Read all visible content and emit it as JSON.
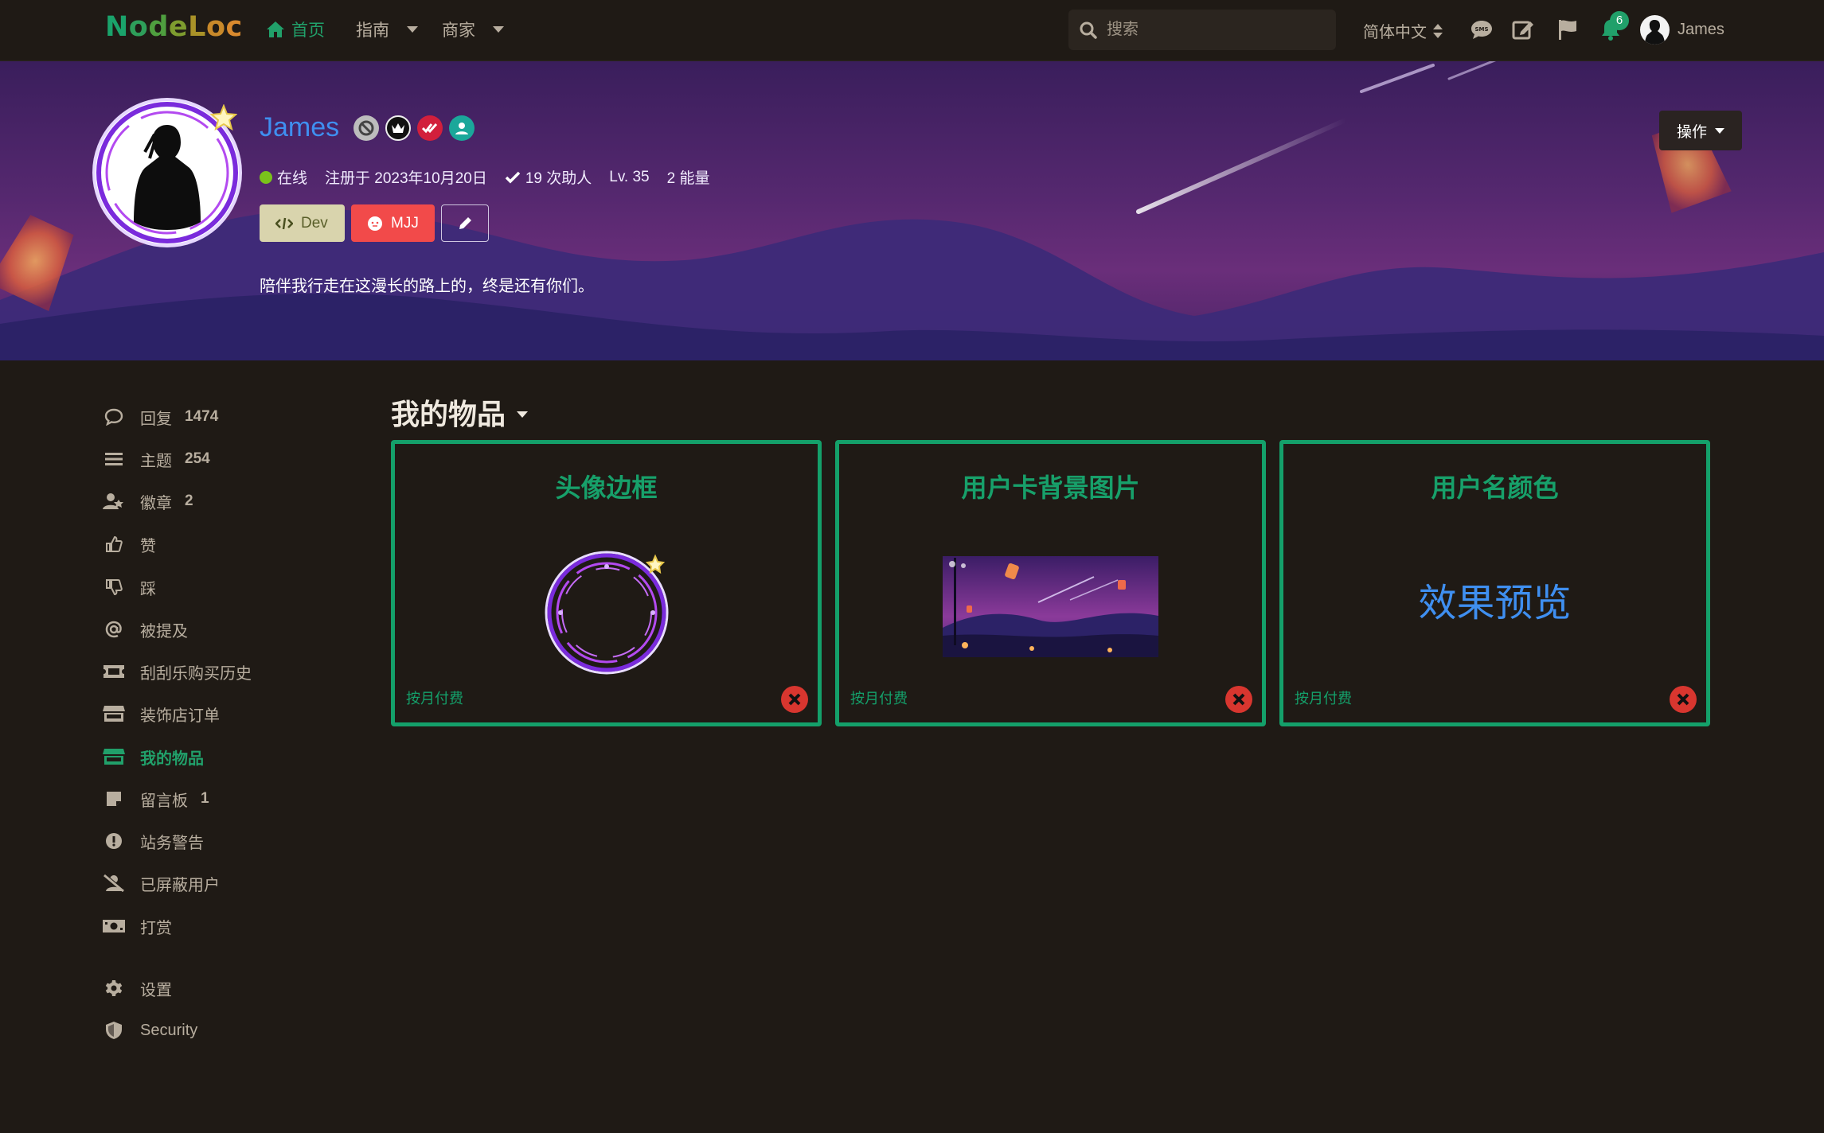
{
  "header": {
    "logo": [
      "N",
      "o",
      "d",
      "e",
      "L",
      "o",
      "c"
    ],
    "nav": {
      "home": "首页",
      "guide": "指南",
      "merchant": "商家"
    },
    "search_placeholder": "搜索",
    "language": "简体中文",
    "notification_count": "6",
    "user_name": "James"
  },
  "profile": {
    "name": "James",
    "status": "在线",
    "registered": "注册于 2023年10月20日",
    "helped": "19 次助人",
    "level": "Lv. 35",
    "energy": "2 能量",
    "roles": {
      "dev": "Dev",
      "mjj": "MJJ"
    },
    "bio": "陪伴我行走在这漫长的路上的，终是还有你们。",
    "action_label": "操作",
    "name_color": "#3f8ff0"
  },
  "sidebar": {
    "items": [
      {
        "label": "回复",
        "count": "1474",
        "icon": "comment-icon"
      },
      {
        "label": "主题",
        "count": "254",
        "icon": "list-icon"
      },
      {
        "label": "徽章",
        "count": "2",
        "icon": "user-badge-icon"
      },
      {
        "label": "赞",
        "count": "",
        "icon": "thumbs-up-icon"
      },
      {
        "label": "踩",
        "count": "",
        "icon": "thumbs-down-icon"
      },
      {
        "label": "被提及",
        "count": "",
        "icon": "at-icon"
      },
      {
        "label": "刮刮乐购买历史",
        "count": "",
        "icon": "ticket-icon"
      },
      {
        "label": "装饰店订单",
        "count": "",
        "icon": "store-icon"
      },
      {
        "label": "我的物品",
        "count": "",
        "icon": "store-icon"
      },
      {
        "label": "留言板",
        "count": "1",
        "icon": "note-icon"
      },
      {
        "label": "站务警告",
        "count": "",
        "icon": "warning-icon"
      },
      {
        "label": "已屏蔽用户",
        "count": "",
        "icon": "user-slash-icon"
      },
      {
        "label": "打赏",
        "count": "",
        "icon": "money-icon"
      }
    ],
    "settings": "设置",
    "security": "Security"
  },
  "main": {
    "section_title": "我的物品",
    "cards": [
      {
        "title": "头像边框",
        "foot": "按月付费"
      },
      {
        "title": "用户卡背景图片",
        "foot": "按月付费"
      },
      {
        "title": "用户名颜色",
        "foot": "按月付费",
        "preview": "效果预览"
      }
    ]
  },
  "colors": {
    "accent": "#21a06a",
    "card_border": "#14a06a",
    "background": "#1f1a15",
    "delete": "#d8362f",
    "mjj": "#f24a4a"
  }
}
